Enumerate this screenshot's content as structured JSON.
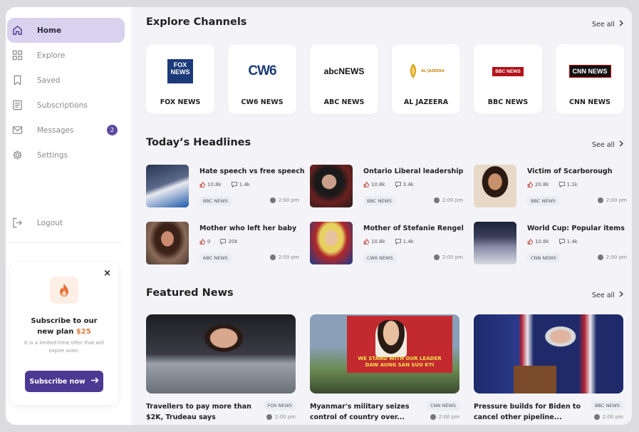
{
  "sidebar": {
    "items": [
      {
        "label": "Home",
        "icon": "home-icon",
        "active": true
      },
      {
        "label": "Explore",
        "icon": "grid-icon"
      },
      {
        "label": "Saved",
        "icon": "bookmark-icon"
      },
      {
        "label": "Subscriptions",
        "icon": "document-icon"
      },
      {
        "label": "Messages",
        "icon": "mail-icon",
        "badge": "2"
      },
      {
        "label": "Settings",
        "icon": "gear-icon"
      }
    ],
    "logout": "Logout"
  },
  "promo": {
    "title_line1": "Subscribe to our",
    "title_line2_prefix": "new plan",
    "price": "$25",
    "text": "It is a limited time offer that will expire soon.",
    "button": "Subscribe now",
    "close": "×"
  },
  "channels": {
    "title": "Explore Channels",
    "see_all": "See all",
    "items": [
      {
        "name": "FOX NEWS",
        "logo": "FOX NEWS"
      },
      {
        "name": "CW6 NEWS",
        "logo": "CW6"
      },
      {
        "name": "ABC NEWS",
        "logo": "abcNEWS"
      },
      {
        "name": "AL JAZEERA",
        "logo": "AL JAZEERA"
      },
      {
        "name": "BBC NEWS",
        "logo": "BBC NEWS"
      },
      {
        "name": "CNN NEWS",
        "logo": "CNN NEWS"
      }
    ]
  },
  "headlines": {
    "title": "Today’s Headlines",
    "see_all": "See all",
    "items": [
      {
        "title": "Hate speech vs free speech",
        "likes": "10.8k",
        "comments": "1.4k",
        "source": "BBC NEWS",
        "time": "2:00 pm"
      },
      {
        "title": "Ontario Liberal leadership",
        "likes": "10.8k",
        "comments": "3.4k",
        "source": "BBC NEWS",
        "time": "2:00 pm"
      },
      {
        "title": "Victim of Scarborough",
        "likes": "20.8k",
        "comments": "1.1k",
        "source": "BBC NEWS",
        "time": "2:00 pm"
      },
      {
        "title": "Mother who left her baby",
        "likes": "0",
        "comments": "20k",
        "source": "ABC NEWS",
        "time": "2:00 pm"
      },
      {
        "title": "Mother of Stefanie Rengel",
        "likes": "10.8k",
        "comments": "1.4k",
        "source": "CW6 NEWS",
        "time": "2:00 pm"
      },
      {
        "title": "World Cup: Popular items",
        "likes": "10.8k",
        "comments": "1.4k",
        "source": "CNN NEWS",
        "time": "2:00 pm"
      }
    ]
  },
  "featured": {
    "title": "Featured News",
    "see_all": "See all",
    "items": [
      {
        "title": "Travellers to pay more than $2K, Trudeau says",
        "source": "FOX NEWS",
        "time": "2:00 pm"
      },
      {
        "title": "Myanmar's military seizes control of country over...",
        "source": "CNN NEWS",
        "time": "2:00 pm",
        "banner": "WE STAND WITH OUR LEADER DAW AUNG SAN SUU KYI"
      },
      {
        "title": "Pressure builds for Biden to cancel other pipeline...",
        "source": "BBC NEWS",
        "time": "2:00 pm"
      }
    ]
  },
  "colors": {
    "accent": "#4a3a92",
    "active_nav": "#d9d2ee",
    "promo_price": "#e07a3a"
  }
}
